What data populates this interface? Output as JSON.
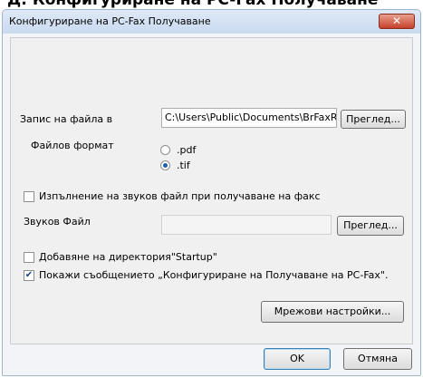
{
  "top_heading": "Д: Конфигуриране на PC-Fax Получаване",
  "window": {
    "title": "Конфигуриране на PC-Fax Получаване",
    "close_glyph": "✕"
  },
  "form": {
    "save_label": "Запис на файла в",
    "save_path": "C:\\Users\\Public\\Documents\\BrFaxR",
    "browse_label": "Преглед...",
    "format_label": "Файлов формат",
    "format_options": [
      {
        "label": ".pdf",
        "selected": false
      },
      {
        "label": ".tif",
        "selected": true
      }
    ],
    "play_sound_label": "Изпълнение на звуков файл при получаване на факс",
    "play_sound_checked": false,
    "sound_file_label": "Звуков Файл",
    "sound_file_value": "",
    "sound_browse_label": "Преглед...",
    "startup_label": "Добавяне на директория\"Startup\"",
    "startup_checked": false,
    "show_message_label": "Покажи съобщението „Конфигуриране на Получаване на PC-Fax\".",
    "show_message_checked": true,
    "network_button": "Мрежови настройки..."
  },
  "footer": {
    "ok_label": "OK",
    "cancel_label": "Отмяна"
  },
  "colors": {
    "titlebar": "#c9daf0",
    "close": "#c7412b",
    "radio_dot": "#1e5fb4"
  }
}
